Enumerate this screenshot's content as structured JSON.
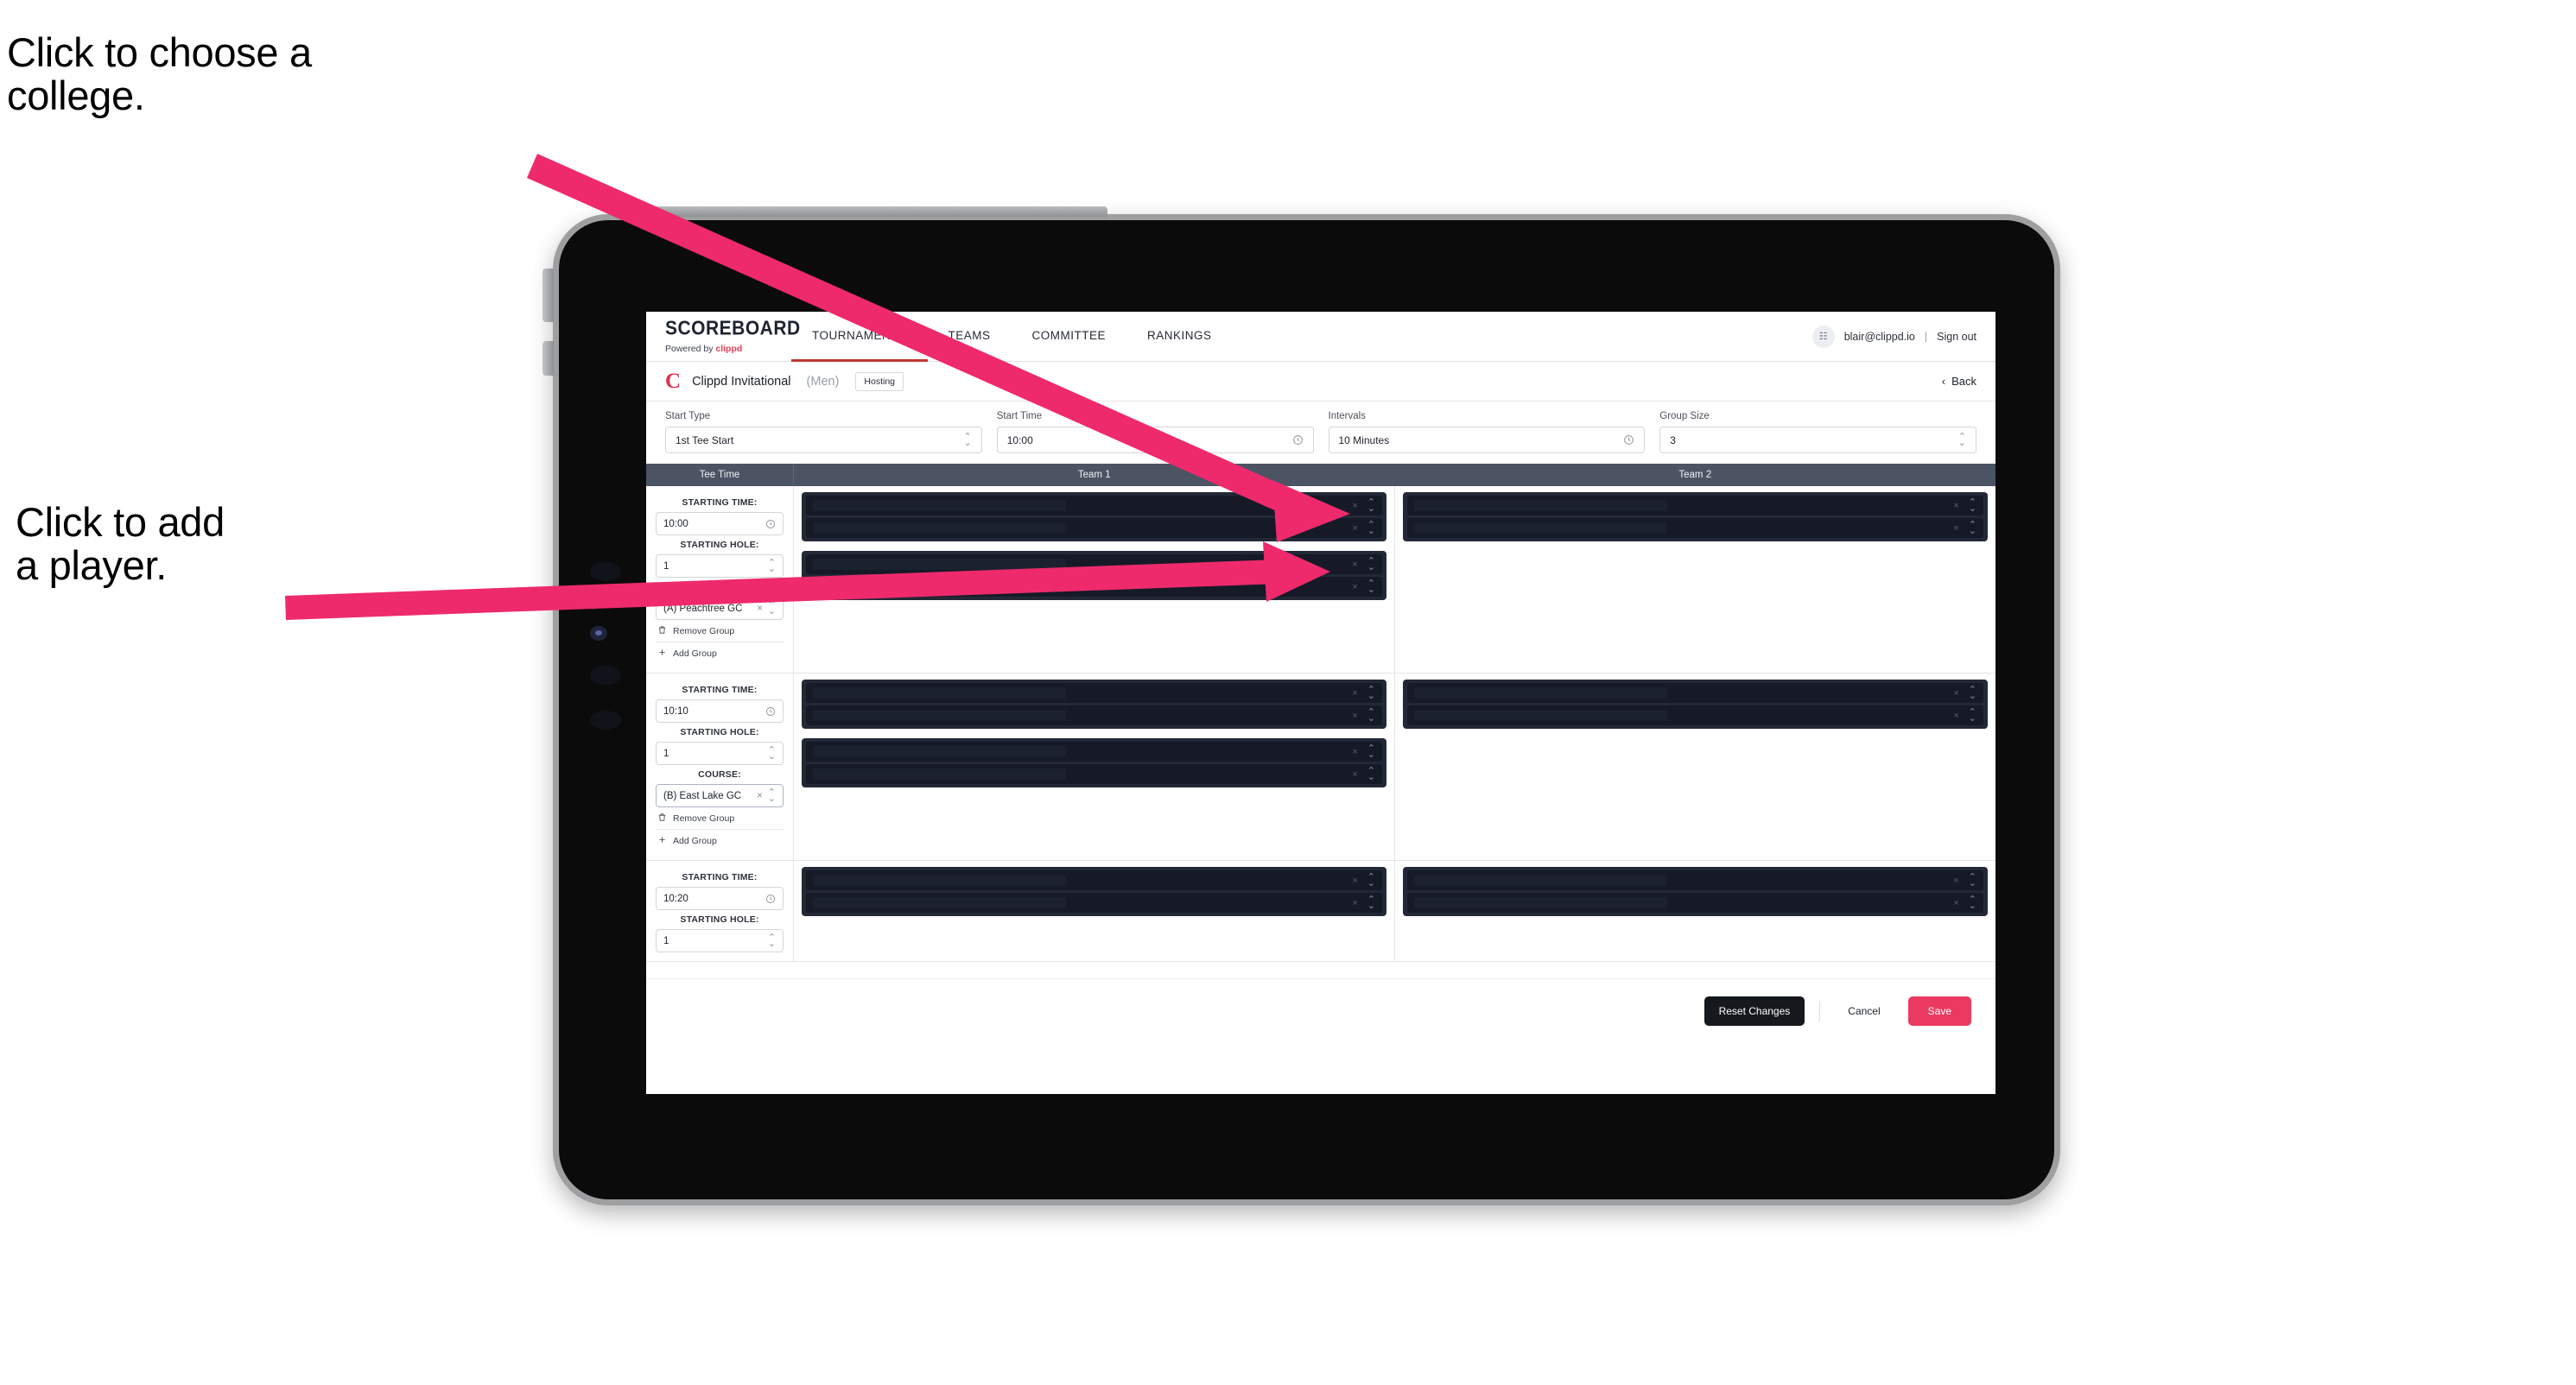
{
  "annotations": {
    "college": "Click to choose a\ncollege.",
    "player": "Click to add\na player."
  },
  "colors": {
    "accent_pink": "#EE2A6C",
    "brand_red": "#E23E57",
    "save_pink": "#EB3A61",
    "table_header": "#4C5363",
    "player_box": "#222836"
  },
  "nav": {
    "brand": {
      "title": "SCOREBOARD",
      "powered_prefix": "Powered by",
      "powered_brand": "clippd"
    },
    "tabs": [
      {
        "label": "TOURNAMENTS",
        "active": true
      },
      {
        "label": "TEAMS",
        "active": false
      },
      {
        "label": "COMMITTEE",
        "active": false
      },
      {
        "label": "RANKINGS",
        "active": false
      }
    ],
    "account": {
      "avatar_glyph": "☷",
      "email": "blair@clippd.io",
      "separator": "|",
      "signout": "Sign out"
    }
  },
  "tournament_bar": {
    "logo_glyph": "C",
    "name": "Clippd Invitational",
    "gender": "(Men)",
    "status_badge": "Hosting",
    "back_label": "Back",
    "back_chevron": "‹"
  },
  "settings": [
    {
      "label": "Start Type",
      "value": "1st Tee Start",
      "control": "select",
      "icon": "stepper-icon"
    },
    {
      "label": "Start Time",
      "value": "10:00",
      "control": "time",
      "icon": "clock-icon"
    },
    {
      "label": "Intervals",
      "value": "10 Minutes",
      "control": "time",
      "icon": "clock-icon"
    },
    {
      "label": "Group Size",
      "value": "3",
      "control": "select",
      "icon": "stepper-icon"
    }
  ],
  "table": {
    "headers": [
      "Tee Time",
      "Team 1",
      "Team 2"
    ],
    "field_labels": {
      "starting_time": "STARTING TIME:",
      "starting_hole": "STARTING HOLE:",
      "course": "COURSE:"
    },
    "group_actions": {
      "remove": "Remove Group",
      "add": "Add Group",
      "remove_icon": "trash-icon",
      "add_icon": "plus-icon"
    },
    "row_icons": {
      "clear": "×",
      "reorder": "⌃⌄"
    },
    "groups": [
      {
        "starting_time": "10:00",
        "starting_hole": "1",
        "course": "(A) Peachtree GC",
        "course_focused": false,
        "team1": [
          {
            "players": 2
          },
          {
            "players": 2
          }
        ],
        "team2": [
          {
            "players": 2
          }
        ]
      },
      {
        "starting_time": "10:10",
        "starting_hole": "1",
        "course": "(B) East Lake GC",
        "course_focused": true,
        "team1": [
          {
            "players": 2
          },
          {
            "players": 2
          }
        ],
        "team2": [
          {
            "players": 2
          }
        ]
      },
      {
        "starting_time": "10:20",
        "starting_hole": "1",
        "course": "",
        "course_focused": false,
        "team1": [
          {
            "players": 2
          }
        ],
        "team2": [
          {
            "players": 2
          }
        ]
      }
    ]
  },
  "footer": {
    "reset": "Reset Changes",
    "cancel": "Cancel",
    "save": "Save"
  }
}
